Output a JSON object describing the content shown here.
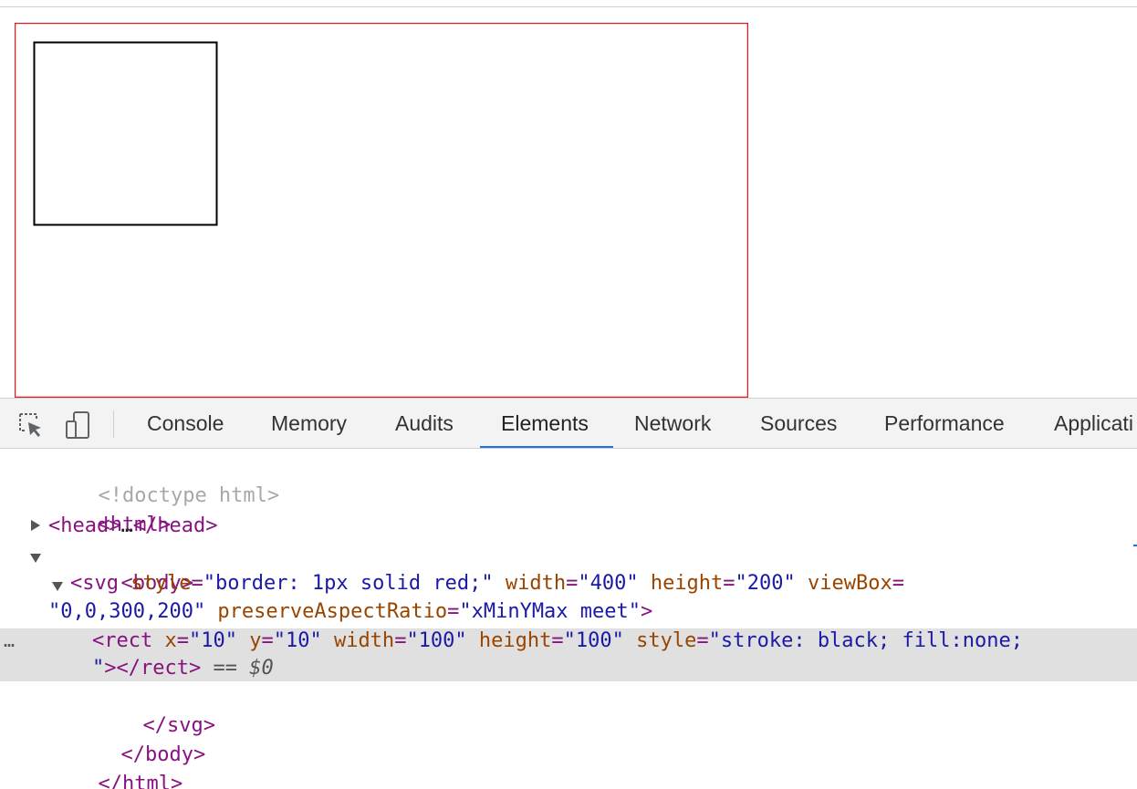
{
  "page": {
    "svg_border_color": "#e02020",
    "rect_stroke_color": "#000000"
  },
  "devtools": {
    "tabs": [
      "Console",
      "Memory",
      "Audits",
      "Elements",
      "Network",
      "Sources",
      "Performance",
      "Applicati"
    ],
    "active_tab": "Elements",
    "accent_color": "#1a73e8",
    "icons": [
      "inspect-element-icon",
      "device-toolbar-icon"
    ]
  },
  "dom": {
    "doctype": "<!doctype html>",
    "html_open": "<html>",
    "head_open": "<head>",
    "head_ellipsis": "…",
    "head_close": "</head>",
    "body_open": "<body>",
    "svg_open_start": "<svg",
    "svg_style_attr": " style",
    "svg_style_val": "\"border: 1px solid red;\"",
    "svg_width_attr": " width",
    "svg_width_val": "\"400\"",
    "svg_height_attr": " height",
    "svg_height_val": "\"200\"",
    "svg_viewbox_attr": " viewBox",
    "svg_viewbox_val": "\"0,0,300,200\"",
    "svg_par_attr": " preserveAspectRatio",
    "svg_par_val": "\"xMinYMax meet\"",
    "svg_open_end": ">",
    "rect_open_start": "<rect",
    "rect_x_attr": " x",
    "rect_x_val": "\"10\"",
    "rect_y_attr": " y",
    "rect_y_val": "\"10\"",
    "rect_w_attr": " width",
    "rect_w_val": "\"100\"",
    "rect_h_attr": " height",
    "rect_h_val": "\"100\"",
    "rect_style_attr": " style",
    "rect_style_val": "\"stroke: black; fill:none;",
    "rect_style_val_end": "\"",
    "rect_close": "></rect>",
    "selected_marker": " == ",
    "selected_var": "$0",
    "equals": "=",
    "svg_close": "</svg>",
    "body_close": "</body>",
    "html_close": "</html>",
    "row_ellipsis": "…"
  }
}
